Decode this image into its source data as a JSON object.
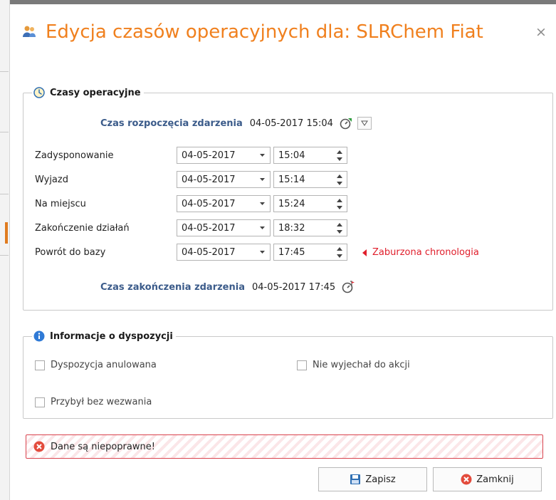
{
  "dialog": {
    "title": "Edycja czasów operacyjnych dla: SLRChem Fiat",
    "close_symbol": "×",
    "title_icon": "users-icon"
  },
  "times_group": {
    "legend": "Czasy operacyjne",
    "legend_icon": "clock-icon",
    "start": {
      "label": "Czas rozpoczęcia zdarzenia",
      "value": "04-05-2017 15:04"
    },
    "end": {
      "label": "Czas zakończenia zdarzenia",
      "value": "04-05-2017 17:45"
    },
    "rows": [
      {
        "label": "Zadysponowanie",
        "date": "04-05-2017",
        "time": "15:04"
      },
      {
        "label": "Wyjazd",
        "date": "04-05-2017",
        "time": "15:14"
      },
      {
        "label": "Na miejscu",
        "date": "04-05-2017",
        "time": "15:24"
      },
      {
        "label": "Zakończenie działań",
        "date": "04-05-2017",
        "time": "18:32"
      },
      {
        "label": "Powrót do bazy",
        "date": "04-05-2017",
        "time": "17:45"
      }
    ],
    "warning": "Zaburzona chronologia"
  },
  "info_group": {
    "legend": "Informacje o dyspozycji",
    "legend_icon": "info-icon",
    "checkboxes": {
      "cancelled": {
        "label": "Dyspozycja anulowana",
        "checked": false
      },
      "not_departed": {
        "label": "Nie wyjechał do akcji",
        "checked": false
      },
      "arrived_uncalled": {
        "label": "Przybył bez wezwania",
        "checked": false
      }
    }
  },
  "error": {
    "text": "Dane są niepoprawne!"
  },
  "buttons": {
    "save": "Zapisz",
    "close": "Zamknij"
  },
  "colors": {
    "title": "#f0801e",
    "event_label": "#3b5b8a",
    "warning": "#e01e2b",
    "error_border": "#d9434e"
  }
}
